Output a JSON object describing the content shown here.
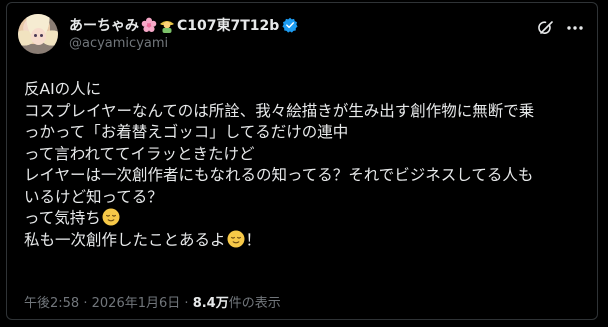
{
  "author": {
    "display_name": "あーちゃみ",
    "event_tag": "C107東7T12b",
    "handle": "@acyamicyami",
    "verified": true
  },
  "post": {
    "lines": [
      "反AIの人に",
      "コスプレイヤーなんてのは所詮、我々絵描きが生み出す創作物に無断で乗",
      "っかって「お着替えゴッコ」してるだけの連中",
      "って言われててイラッときたけど",
      "レイヤーは一次創作者にもなれるの知ってる？それでビジネスしてる人も",
      "いるけど知ってる？",
      "って気持ち",
      "私も一次創作したことあるよ",
      "！"
    ]
  },
  "meta": {
    "time": "午後2:58",
    "separator": "·",
    "date": "2026年1月6日",
    "views_count": "8.4万",
    "views_label": "件の表示"
  },
  "icons": {
    "name_emoji_1": "cherry-blossom-icon",
    "name_emoji_2": "woman-farmer-icon",
    "verified": "verified-badge-icon",
    "grok": "grok-icon",
    "more": "more-options-icon",
    "inline_emoji": "relieved-face-icon"
  },
  "colors": {
    "background": "#000000",
    "text_primary": "#e7e9ea",
    "text_secondary": "#71767b",
    "border": "#2f3336",
    "verified_blue": "#1d9bf0"
  }
}
